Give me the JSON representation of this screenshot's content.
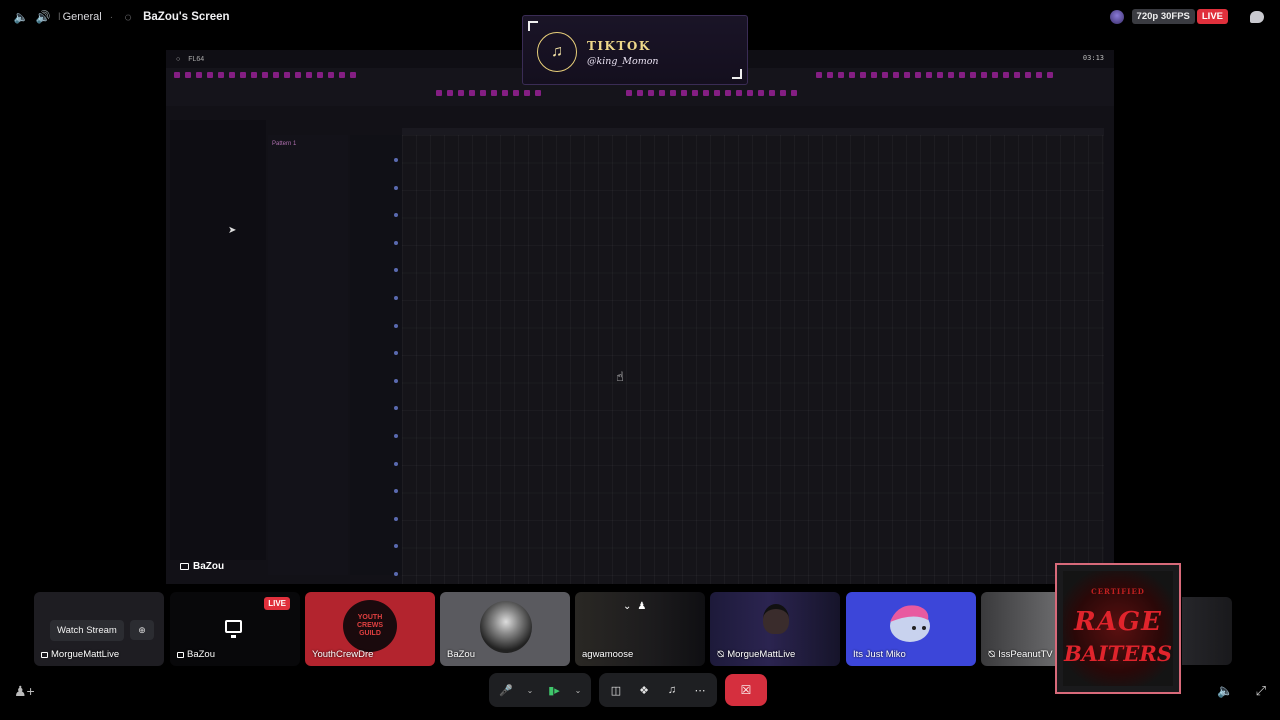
{
  "topbar": {
    "channel_name": "General",
    "stream_title": "BaZou's Screen",
    "quality": "720p 30FPS",
    "live_badge": "LIVE"
  },
  "stream": {
    "streamer_label": "BaZou",
    "daw": {
      "app_name": "FL64",
      "clock": "03:13",
      "pattern_name": "Pattern 1"
    }
  },
  "overlay": {
    "title": "TIKTOK",
    "handle": "@king_Momon"
  },
  "participants": [
    {
      "name": "MorgueMattLive",
      "action": "Watch Stream",
      "type": "stream"
    },
    {
      "name": "BaZou",
      "badge": "LIVE",
      "type": "stream"
    },
    {
      "name": "YouthCrewDre",
      "type": "user"
    },
    {
      "name": "BaZou",
      "type": "user"
    },
    {
      "name": "agwamoose",
      "type": "user"
    },
    {
      "name": "MorgueMattLive",
      "type": "user",
      "muted": true
    },
    {
      "name": "Its Just Miko",
      "type": "user"
    },
    {
      "name": "IssPeanutTV",
      "type": "user",
      "muted": true
    }
  ],
  "rage_card": {
    "small_text": "CERTIFIED",
    "line1": "RAGE",
    "line2": "BAITERS"
  },
  "icons": {
    "volume": "volume-icon",
    "voice": "speaker-icon",
    "screen": "screen-share-icon",
    "chat": "chat-icon",
    "mic": "microphone-icon",
    "camera": "camera-icon",
    "share": "share-screen-icon",
    "activities": "activities-icon",
    "soundboard": "soundboard-icon",
    "more": "more-icon",
    "leave": "leave-call-icon"
  },
  "colors": {
    "live": "#e0303c",
    "leave": "#d52f3e",
    "camera_on": "#3fc76b",
    "overlay_gold": "#efd98a"
  }
}
